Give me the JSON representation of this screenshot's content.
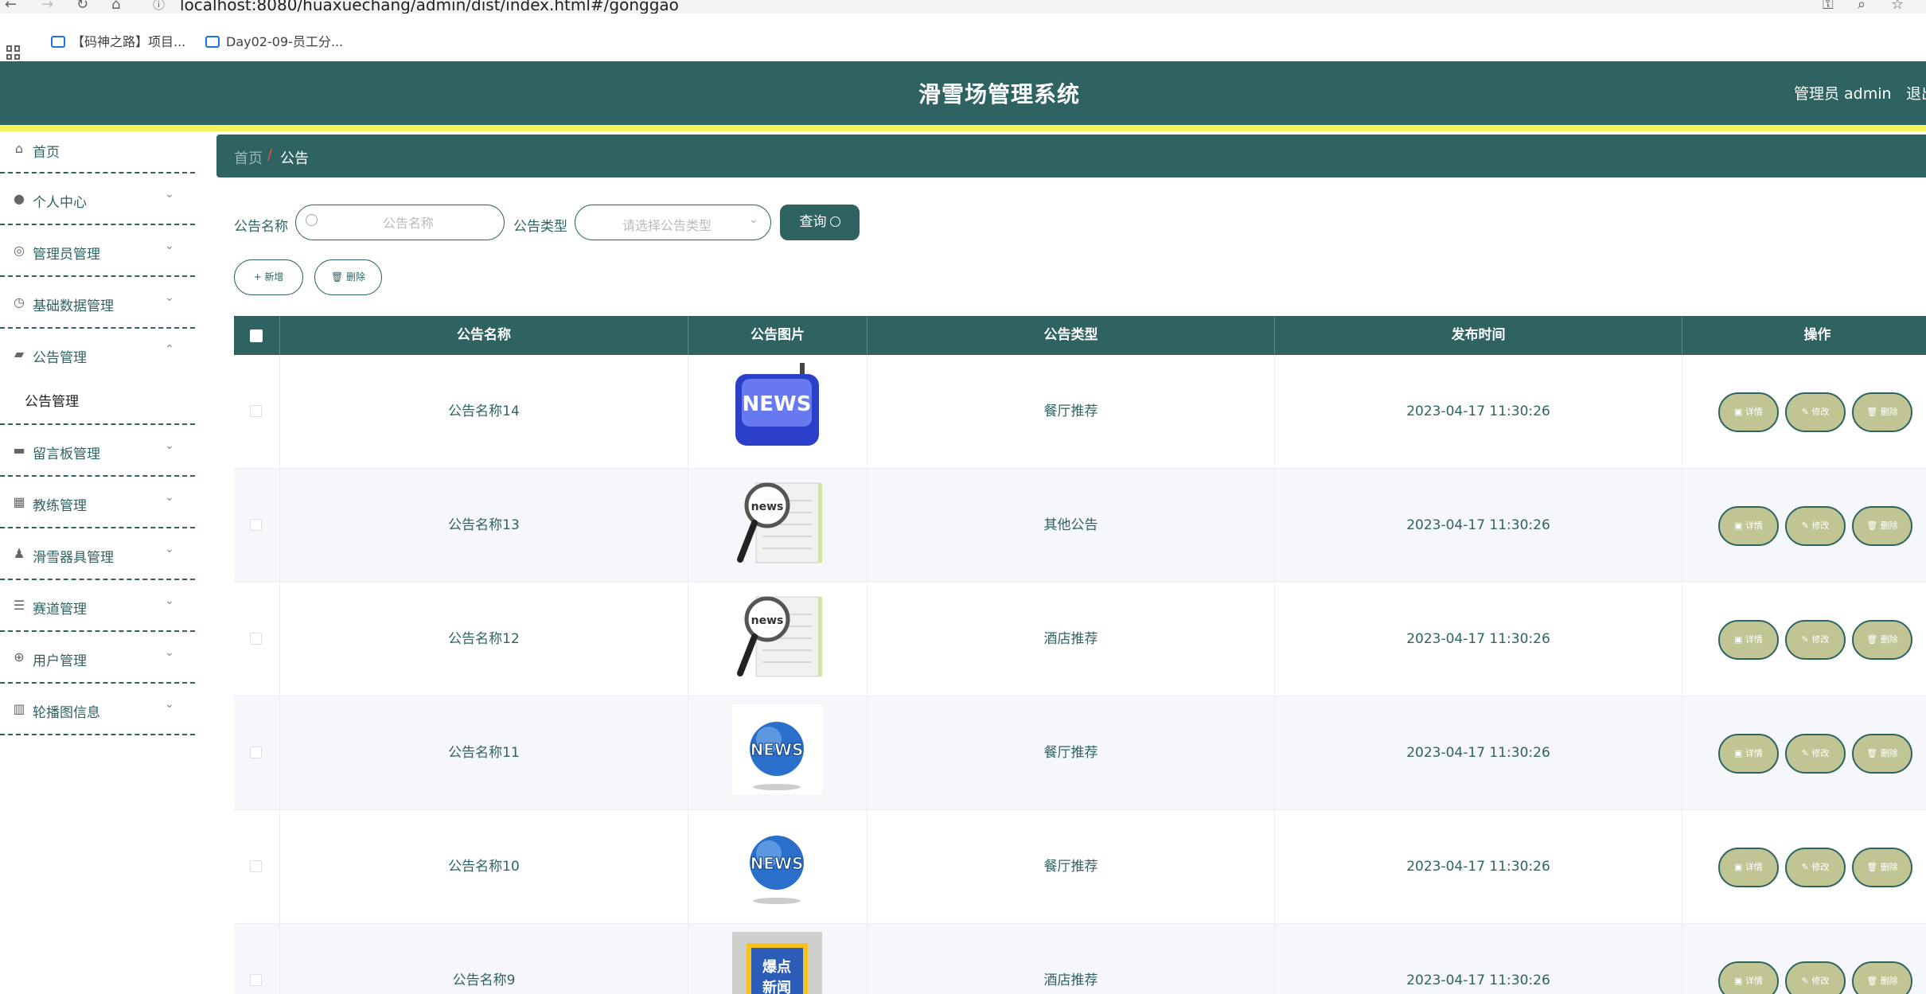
{
  "browser": {
    "url": "localhost:8080/huaxuechang/admin/dist/index.html#/gonggao",
    "bookmarks": [
      "【码神之路】项目...",
      "Day02-09-员工分..."
    ]
  },
  "header": {
    "title": "滑雪场管理系统",
    "user": "管理员 admin",
    "logout": "退出"
  },
  "sidebar": {
    "items": [
      {
        "label": "首页",
        "icon": "home-icon"
      },
      {
        "label": "个人中心",
        "icon": "user-icon"
      },
      {
        "label": "管理员管理",
        "icon": "admin-icon"
      },
      {
        "label": "基础数据管理",
        "icon": "clock-icon"
      },
      {
        "label": "公告管理",
        "icon": "ticket-icon",
        "submenu": [
          "公告管理"
        ]
      },
      {
        "label": "留言板管理",
        "icon": "briefcase-icon"
      },
      {
        "label": "教练管理",
        "icon": "grid-icon"
      },
      {
        "label": "滑雪器具管理",
        "icon": "person-icon"
      },
      {
        "label": "赛道管理",
        "icon": "list-icon"
      },
      {
        "label": "用户管理",
        "icon": "target-icon"
      },
      {
        "label": "轮播图信息",
        "icon": "bars-icon"
      }
    ]
  },
  "breadcrumb": {
    "home": "首页",
    "sep": "/",
    "current": "公告"
  },
  "filters": {
    "name_label": "公告名称",
    "name_placeholder": "公告名称",
    "type_label": "公告类型",
    "type_placeholder": "请选择公告类型",
    "query_label": "查询"
  },
  "toolbar": {
    "add_label": "+ 新增",
    "delete_label": "删除"
  },
  "table": {
    "headers": [
      "公告名称",
      "公告图片",
      "公告类型",
      "发布时间",
      "操作"
    ],
    "action_labels": {
      "detail": "详情",
      "edit": "修改",
      "delete": "删除"
    },
    "rows": [
      {
        "name": "公告名称14",
        "image": "news-key",
        "type": "餐厅推荐",
        "time": "2023-04-17 11:30:26"
      },
      {
        "name": "公告名称13",
        "image": "news-magnifier",
        "type": "其他公告",
        "time": "2023-04-17 11:30:26"
      },
      {
        "name": "公告名称12",
        "image": "news-magnifier",
        "type": "酒店推荐",
        "time": "2023-04-17 11:30:26"
      },
      {
        "name": "公告名称11",
        "image": "news-globe",
        "type": "餐厅推荐",
        "time": "2023-04-17 11:30:26"
      },
      {
        "name": "公告名称10",
        "image": "news-globe",
        "type": "餐厅推荐",
        "time": "2023-04-17 11:30:26"
      },
      {
        "name": "公告名称9",
        "image": "hot-news",
        "type": "酒店推荐",
        "time": "2023-04-17 11:30:26"
      }
    ]
  },
  "colors": {
    "primary": "#2e6362",
    "accent": "#f6f45a",
    "action_button": "#c1c594"
  }
}
